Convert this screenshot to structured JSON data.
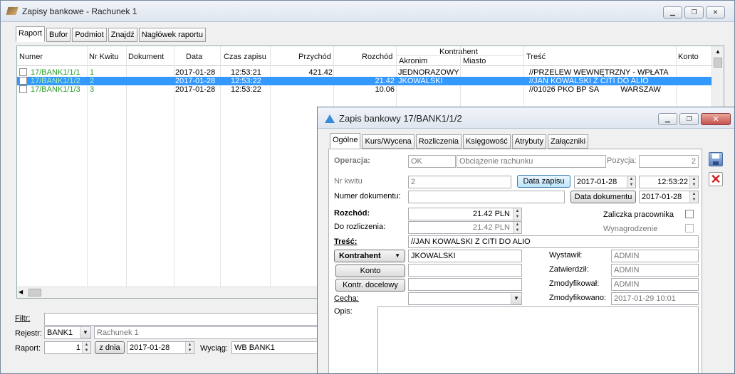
{
  "main": {
    "title": "Zapisy bankowe - Rachunek 1",
    "tabs": [
      "Raport",
      "Bufor",
      "Podmiot",
      "Znajdź",
      "Nagłówek raportu"
    ],
    "columns": {
      "numer": "Numer",
      "nr_kwitu": "Nr Kwitu",
      "dokument": "Dokument",
      "data": "Data",
      "czas": "Czas zapisu",
      "przychod": "Przychód",
      "rozchod": "Rozchód",
      "kontrahent": "Kontrahent",
      "akronim": "Akronim",
      "miasto": "Miasto",
      "tresc": "Treść",
      "konto": "Konto"
    },
    "rows": [
      {
        "numer": "17/BANK1/1/1",
        "kwit": "1",
        "data": "2017-01-28",
        "czas": "12:53:21",
        "przychod": "421.42",
        "rozchod": "",
        "akronim": "JEDNORAZOWY",
        "miasto": "",
        "tresc": "//PRZELEW WEWNĘTRZNY - WPŁATA"
      },
      {
        "numer": "17/BANK1/1/2",
        "kwit": "2",
        "data": "2017-01-28",
        "czas": "12:53:22",
        "przychod": "",
        "rozchod": "21.42",
        "akronim": "JKOWALSKI",
        "miasto": "",
        "tresc": "//JAN KOWALSKI Z CITI DO ALIO"
      },
      {
        "numer": "17/BANK1/1/3",
        "kwit": "3",
        "data": "2017-01-28",
        "czas": "12:53:22",
        "przychod": "",
        "rozchod": "10.06",
        "akronim": "",
        "miasto": "",
        "tresc": "//01026 PKO BP SA          WARSZAW"
      }
    ],
    "filter": {
      "filtr_label": "Filtr:",
      "rejestr_label": "Rejestr:",
      "rejestr_value": "BANK1",
      "rejestr_name": "Rachunek 1",
      "raport_label": "Raport:",
      "raport_value": "1",
      "z_dnia_label": "z dnia",
      "z_dnia_value": "2017-01-28",
      "wyciag_label": "Wyciąg:",
      "wyciag_value": "WB BANK1"
    }
  },
  "dialog": {
    "title": "Zapis bankowy 17/BANK1/1/2",
    "tabs": [
      "Ogólne",
      "Kurs/Wycena",
      "Rozliczenia",
      "Księgowość",
      "Atrybuty",
      "Załączniki"
    ],
    "operacja_label": "Operacja:",
    "operacja_code": "OK",
    "operacja_name": "Obciążenie rachunku",
    "pozycja_label": "Pozycja:",
    "pozycja_value": "2",
    "nr_kwitu_label": "Nr kwitu",
    "nr_kwitu_value": "2",
    "data_zapisu_btn": "Data zapisu",
    "data_zapisu_value": "2017-01-28",
    "czas_value": "12:53:22",
    "numer_dok_label": "Numer dokumentu:",
    "numer_dok_value": "",
    "data_dok_btn": "Data dokumentu",
    "data_dok_value": "2017-01-28",
    "rozchod_label": "Rozchód:",
    "rozchod_value": "21.42 PLN",
    "do_rozliczenia_label": "Do rozliczenia:",
    "do_rozliczenia_value": "21.42 PLN",
    "zaliczka_label": "Zaliczka pracownika",
    "wynagrodzenie_label": "Wynagrodzenie",
    "tresc_label": "Treść:",
    "tresc_value": "//JAN KOWALSKI Z CITI DO ALIO",
    "kontrahent_btn": "Kontrahent",
    "kontrahent_value": "JKOWALSKI",
    "konto_btn": "Konto",
    "kontr_docelowy_btn": "Kontr. docelowy",
    "cecha_label": "Cecha:",
    "opis_label": "Opis:",
    "wystawil_label": "Wystawił:",
    "wystawil_value": "ADMIN",
    "zatwierdzil_label": "Zatwierdził:",
    "zatwierdzil_value": "ADMIN",
    "zmodyfikowal_label": "Zmodyfikował:",
    "zmodyfikowal_value": "ADMIN",
    "zmodyfikowano_label": "Zmodyfikowano:",
    "zmodyfikowano_value": "2017-01-29 10:01"
  }
}
